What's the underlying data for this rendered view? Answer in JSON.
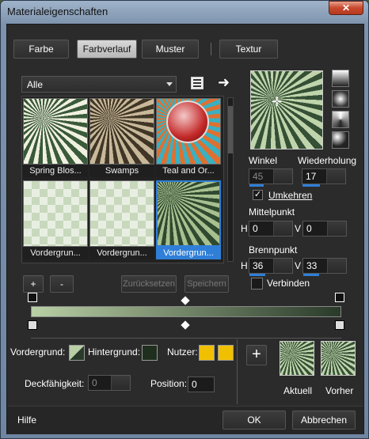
{
  "window": {
    "title": "Materialeigenschaften",
    "close_label": "✕"
  },
  "tabs": [
    "Farbe",
    "Farbverlauf",
    "Muster",
    "Textur"
  ],
  "dropdown": {
    "value": "Alle"
  },
  "thumbnails": [
    {
      "label": "Spring Blos..."
    },
    {
      "label": "Swamps"
    },
    {
      "label": "Teal and Or..."
    },
    {
      "label": "Vordergrun..."
    },
    {
      "label": "Vordergrun..."
    },
    {
      "label": "Vordergrun..."
    }
  ],
  "buttons": {
    "plus": "+",
    "minus": "-",
    "reset": "Zurücksetzen",
    "save": "Speichern",
    "ok": "OK",
    "cancel": "Abbrechen",
    "help": "Hilfe",
    "add": "+"
  },
  "angle": {
    "label": "Winkel",
    "value": "45"
  },
  "repeat": {
    "label": "Wiederholung",
    "value": "17"
  },
  "invert": {
    "label": "Umkehren",
    "checked": true
  },
  "center": {
    "label": "Mittelpunkt",
    "h": "0",
    "v": "0"
  },
  "focus": {
    "label": "Brennpunkt",
    "h": "36",
    "v": "33"
  },
  "link": {
    "label": "Verbinden"
  },
  "hv": {
    "h": "H",
    "v": "V"
  },
  "bottom": {
    "foreground": "Vordergrund:",
    "background": "Hintergrund:",
    "user": "Nutzer:",
    "opacity_label": "Deckfähigkeit:",
    "opacity": "0",
    "position_label": "Position:",
    "position": "0",
    "current": "Aktuell",
    "previous": "Vorher"
  },
  "colors": {
    "accent": "#2f7fd8",
    "user": "#f0c000",
    "gradient_start": "#b9cfa5",
    "gradient_end": "#2a3a2a"
  }
}
